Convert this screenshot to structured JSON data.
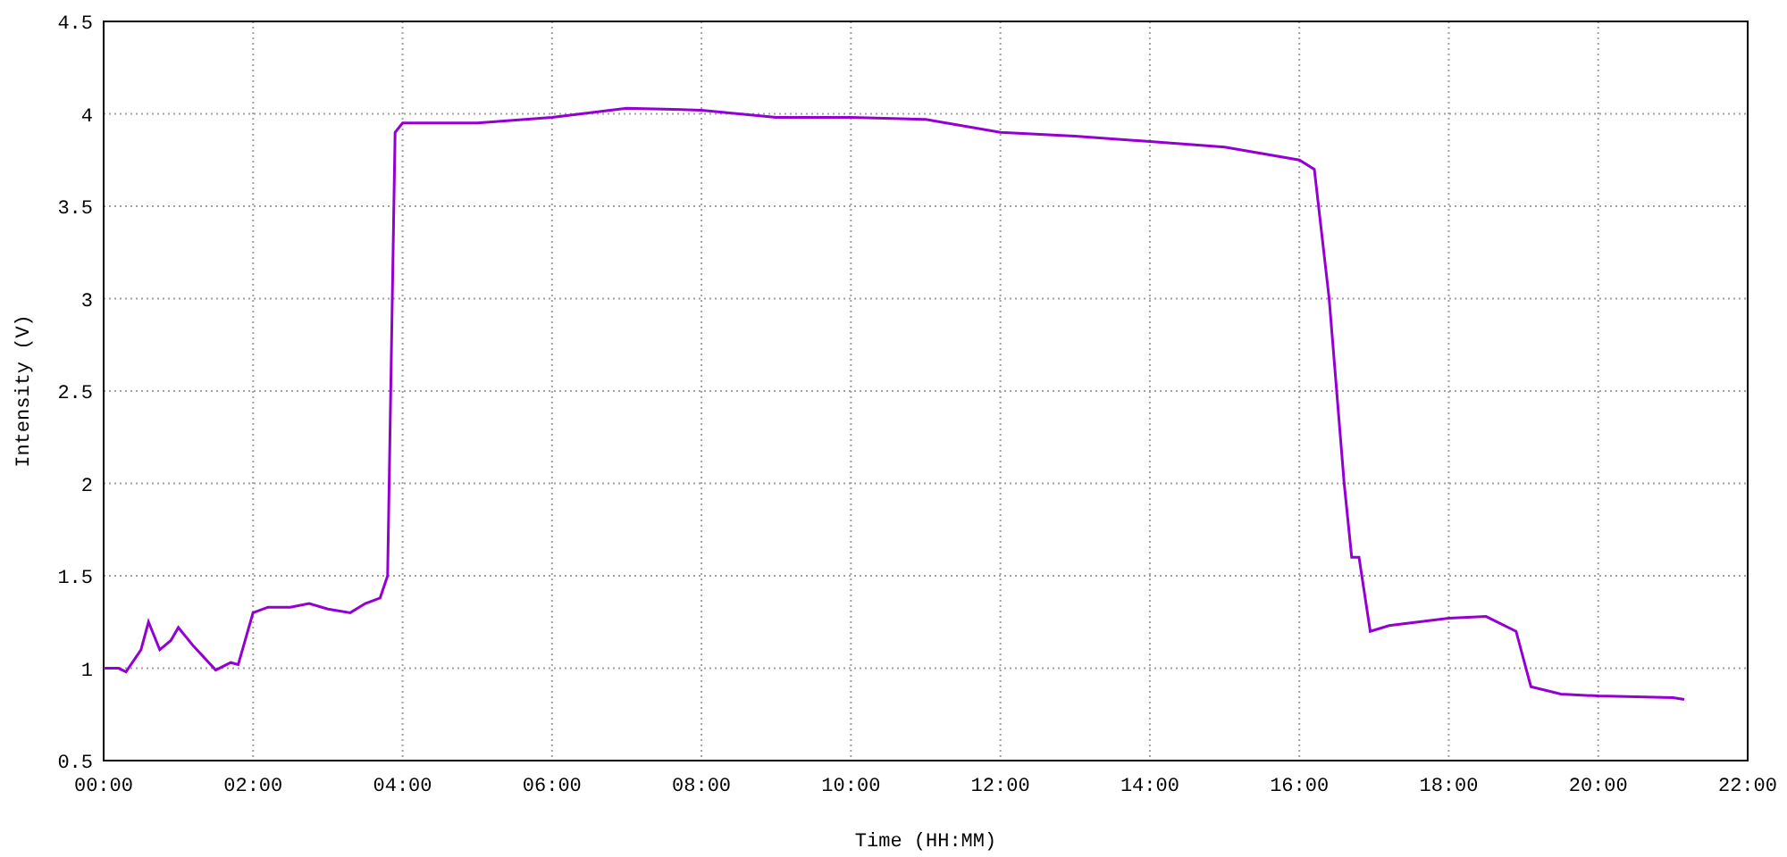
{
  "chart_data": {
    "type": "line",
    "xlabel": "Time (HH:MM)",
    "ylabel": "Intensity (V)",
    "grid": true,
    "xlim": [
      0,
      22
    ],
    "ylim": [
      0.5,
      4.5
    ],
    "xticks": [
      {
        "value": 0,
        "label": "00:00"
      },
      {
        "value": 2,
        "label": "02:00"
      },
      {
        "value": 4,
        "label": "04:00"
      },
      {
        "value": 6,
        "label": "06:00"
      },
      {
        "value": 8,
        "label": "08:00"
      },
      {
        "value": 10,
        "label": "10:00"
      },
      {
        "value": 12,
        "label": "12:00"
      },
      {
        "value": 14,
        "label": "14:00"
      },
      {
        "value": 16,
        "label": "16:00"
      },
      {
        "value": 18,
        "label": "18:00"
      },
      {
        "value": 20,
        "label": "20:00"
      },
      {
        "value": 22,
        "label": "22:00"
      }
    ],
    "yticks": [
      {
        "value": 0.5,
        "label": "0.5"
      },
      {
        "value": 1,
        "label": "1"
      },
      {
        "value": 1.5,
        "label": "1.5"
      },
      {
        "value": 2,
        "label": "2"
      },
      {
        "value": 2.5,
        "label": "2.5"
      },
      {
        "value": 3,
        "label": "3"
      },
      {
        "value": 3.5,
        "label": "3.5"
      },
      {
        "value": 4,
        "label": "4"
      },
      {
        "value": 4.5,
        "label": "4.5"
      }
    ],
    "x": [
      0,
      0.2,
      0.3,
      0.5,
      0.6,
      0.75,
      0.9,
      1.0,
      1.2,
      1.5,
      1.7,
      1.8,
      2.0,
      2.2,
      2.5,
      2.75,
      3.0,
      3.3,
      3.5,
      3.7,
      3.8,
      3.9,
      4.0,
      5,
      6,
      7,
      8,
      9,
      10,
      11,
      12,
      13,
      14,
      15,
      16,
      16.2,
      16.4,
      16.6,
      16.7,
      16.8,
      16.95,
      17.2,
      18,
      18.5,
      18.9,
      19.1,
      19.5,
      20,
      21,
      21.15
    ],
    "series": [
      {
        "color": "#9400d3",
        "values": [
          1.0,
          1.0,
          0.98,
          1.1,
          1.25,
          1.1,
          1.15,
          1.22,
          1.12,
          0.99,
          1.03,
          1.02,
          1.3,
          1.33,
          1.33,
          1.35,
          1.32,
          1.3,
          1.35,
          1.38,
          1.5,
          3.9,
          3.95,
          3.95,
          3.98,
          4.03,
          4.02,
          3.98,
          3.98,
          3.97,
          3.9,
          3.88,
          3.85,
          3.82,
          3.75,
          3.7,
          3.0,
          2.0,
          1.6,
          1.6,
          1.2,
          1.23,
          1.27,
          1.28,
          1.2,
          0.9,
          0.86,
          0.85,
          0.84,
          0.83
        ]
      }
    ]
  }
}
